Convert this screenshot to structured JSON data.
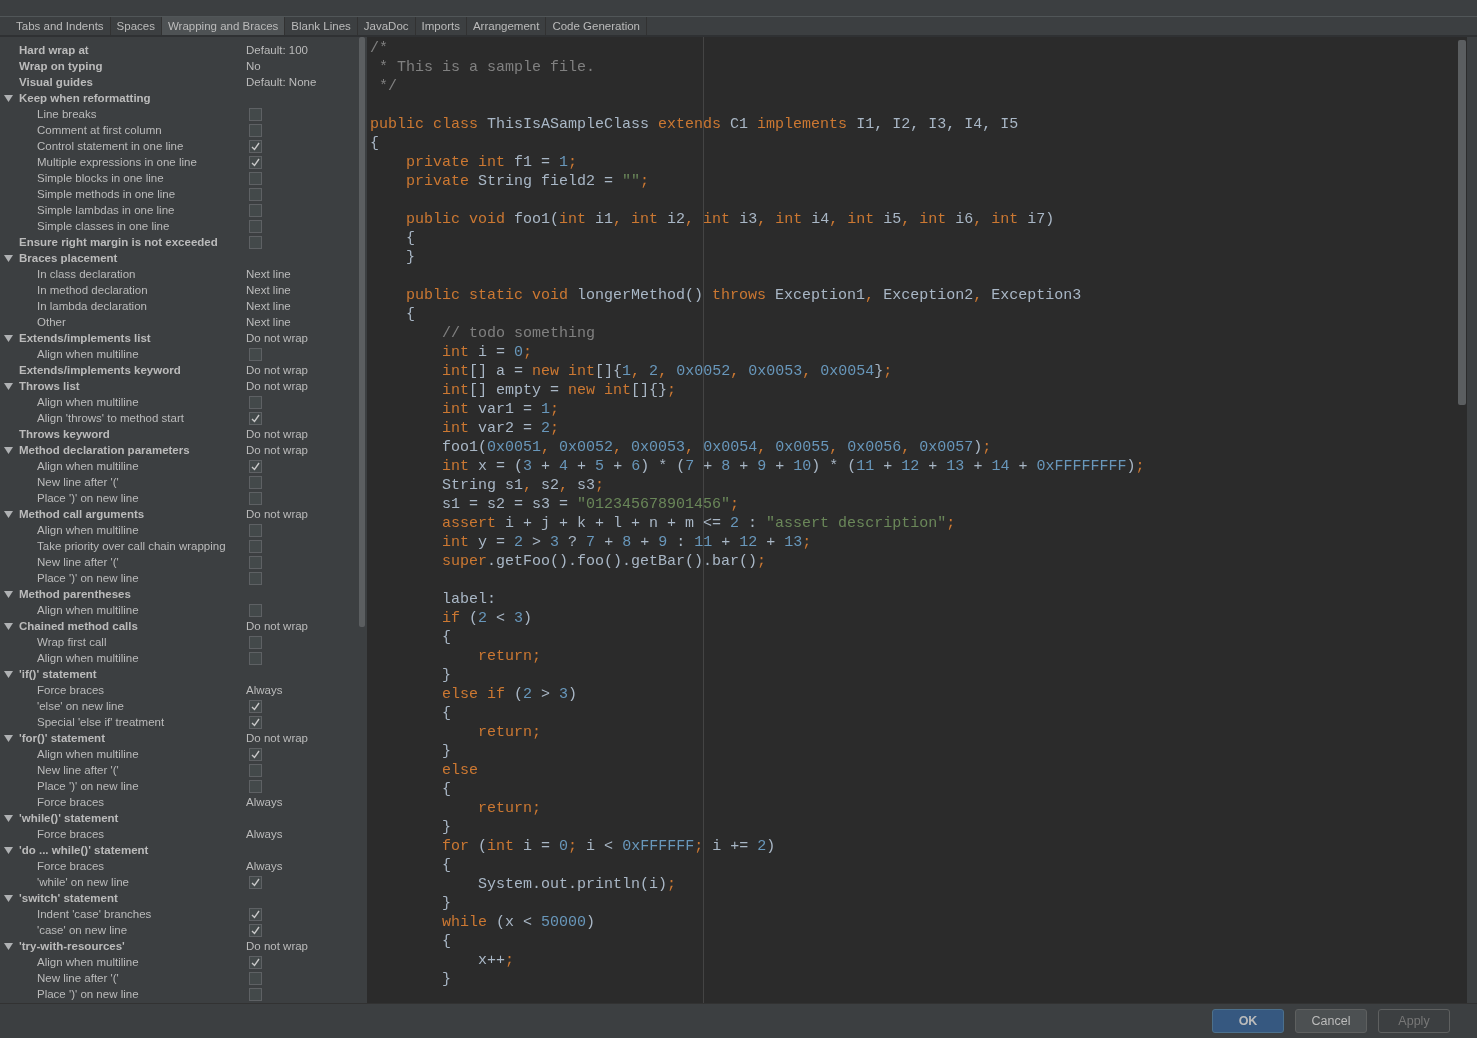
{
  "tabs": [
    {
      "label": "Tabs and Indents",
      "selected": false
    },
    {
      "label": "Spaces",
      "selected": false
    },
    {
      "label": "Wrapping and Braces",
      "selected": true
    },
    {
      "label": "Blank Lines",
      "selected": false
    },
    {
      "label": "JavaDoc",
      "selected": false
    },
    {
      "label": "Imports",
      "selected": false
    },
    {
      "label": "Arrangement",
      "selected": false
    },
    {
      "label": "Code Generation",
      "selected": false
    }
  ],
  "settings": [
    {
      "label": "Hard wrap at",
      "kind": "text",
      "value": "Default: 100"
    },
    {
      "label": "Wrap on typing",
      "kind": "text",
      "value": "No"
    },
    {
      "label": "Visual guides",
      "kind": "text",
      "value": "Default: None"
    },
    {
      "label": "Keep when reformatting",
      "kind": "none",
      "expanded": true,
      "children": [
        {
          "label": "Line breaks",
          "kind": "checkbox",
          "checked": false
        },
        {
          "label": "Comment at first column",
          "kind": "checkbox",
          "checked": false
        },
        {
          "label": "Control statement in one line",
          "kind": "checkbox",
          "checked": true
        },
        {
          "label": "Multiple expressions in one line",
          "kind": "checkbox",
          "checked": true
        },
        {
          "label": "Simple blocks in one line",
          "kind": "checkbox",
          "checked": false
        },
        {
          "label": "Simple methods in one line",
          "kind": "checkbox",
          "checked": false
        },
        {
          "label": "Simple lambdas in one line",
          "kind": "checkbox",
          "checked": false
        },
        {
          "label": "Simple classes in one line",
          "kind": "checkbox",
          "checked": false
        }
      ]
    },
    {
      "label": "Ensure right margin is not exceeded",
      "kind": "checkbox",
      "checked": false
    },
    {
      "label": "Braces placement",
      "kind": "none",
      "expanded": true,
      "children": [
        {
          "label": "In class declaration",
          "kind": "text",
          "value": "Next line"
        },
        {
          "label": "In method declaration",
          "kind": "text",
          "value": "Next line"
        },
        {
          "label": "In lambda declaration",
          "kind": "text",
          "value": "Next line"
        },
        {
          "label": "Other",
          "kind": "text",
          "value": "Next line"
        }
      ]
    },
    {
      "label": "Extends/implements list",
      "kind": "text",
      "value": "Do not wrap",
      "expanded": true,
      "children": [
        {
          "label": "Align when multiline",
          "kind": "checkbox",
          "checked": false
        }
      ]
    },
    {
      "label": "Extends/implements keyword",
      "kind": "text",
      "value": "Do not wrap"
    },
    {
      "label": "Throws list",
      "kind": "text",
      "value": "Do not wrap",
      "expanded": true,
      "children": [
        {
          "label": "Align when multiline",
          "kind": "checkbox",
          "checked": false
        },
        {
          "label": "Align 'throws' to method start",
          "kind": "checkbox",
          "checked": true
        }
      ]
    },
    {
      "label": "Throws keyword",
      "kind": "text",
      "value": "Do not wrap"
    },
    {
      "label": "Method declaration parameters",
      "kind": "text",
      "value": "Do not wrap",
      "expanded": true,
      "children": [
        {
          "label": "Align when multiline",
          "kind": "checkbox",
          "checked": true
        },
        {
          "label": "New line after '('",
          "kind": "checkbox",
          "checked": false
        },
        {
          "label": "Place ')' on new line",
          "kind": "checkbox",
          "checked": false
        }
      ]
    },
    {
      "label": "Method call arguments",
      "kind": "text",
      "value": "Do not wrap",
      "expanded": true,
      "children": [
        {
          "label": "Align when multiline",
          "kind": "checkbox",
          "checked": false
        },
        {
          "label": "Take priority over call chain wrapping",
          "kind": "checkbox",
          "checked": false
        },
        {
          "label": "New line after '('",
          "kind": "checkbox",
          "checked": false
        },
        {
          "label": "Place ')' on new line",
          "kind": "checkbox",
          "checked": false
        }
      ]
    },
    {
      "label": "Method parentheses",
      "kind": "none",
      "expanded": true,
      "children": [
        {
          "label": "Align when multiline",
          "kind": "checkbox",
          "checked": false
        }
      ]
    },
    {
      "label": "Chained method calls",
      "kind": "text",
      "value": "Do not wrap",
      "expanded": true,
      "children": [
        {
          "label": "Wrap first call",
          "kind": "checkbox",
          "checked": false
        },
        {
          "label": "Align when multiline",
          "kind": "checkbox",
          "checked": false
        }
      ]
    },
    {
      "label": "'if()' statement",
      "kind": "none",
      "expanded": true,
      "children": [
        {
          "label": "Force braces",
          "kind": "text",
          "value": "Always"
        },
        {
          "label": "'else' on new line",
          "kind": "checkbox",
          "checked": true
        },
        {
          "label": "Special 'else if' treatment",
          "kind": "checkbox",
          "checked": true
        }
      ]
    },
    {
      "label": "'for()' statement",
      "kind": "text",
      "value": "Do not wrap",
      "expanded": true,
      "children": [
        {
          "label": "Align when multiline",
          "kind": "checkbox",
          "checked": true
        },
        {
          "label": "New line after '('",
          "kind": "checkbox",
          "checked": false
        },
        {
          "label": "Place ')' on new line",
          "kind": "checkbox",
          "checked": false
        },
        {
          "label": "Force braces",
          "kind": "text",
          "value": "Always"
        }
      ]
    },
    {
      "label": "'while()' statement",
      "kind": "none",
      "expanded": true,
      "children": [
        {
          "label": "Force braces",
          "kind": "text",
          "value": "Always"
        }
      ]
    },
    {
      "label": "'do ... while()' statement",
      "kind": "none",
      "expanded": true,
      "children": [
        {
          "label": "Force braces",
          "kind": "text",
          "value": "Always"
        },
        {
          "label": "'while' on new line",
          "kind": "checkbox",
          "checked": true
        }
      ]
    },
    {
      "label": "'switch' statement",
      "kind": "none",
      "expanded": true,
      "children": [
        {
          "label": "Indent 'case' branches",
          "kind": "checkbox",
          "checked": true
        },
        {
          "label": "'case' on new line",
          "kind": "checkbox",
          "checked": true
        }
      ]
    },
    {
      "label": "'try-with-resources'",
      "kind": "text",
      "value": "Do not wrap",
      "expanded": true,
      "children": [
        {
          "label": "Align when multiline",
          "kind": "checkbox",
          "checked": true
        },
        {
          "label": "New line after '('",
          "kind": "checkbox",
          "checked": false
        },
        {
          "label": "Place ')' on new line",
          "kind": "checkbox",
          "checked": false
        }
      ]
    }
  ],
  "code_lines": [
    [
      {
        "kind": "comment",
        "text": "/*"
      }
    ],
    [
      {
        "kind": "comment",
        "text": " * This is a sample file."
      }
    ],
    [
      {
        "kind": "comment",
        "text": " */"
      }
    ],
    {
      "blank_before": true,
      "tokens": [
        {
          "kind": "keyword",
          "text": "public class "
        },
        {
          "kind": "plain",
          "text": "ThisIsASampleClass "
        },
        {
          "kind": "keyword",
          "text": "extends "
        },
        {
          "kind": "plain",
          "text": "C1 "
        },
        {
          "kind": "keyword",
          "text": "implements "
        },
        {
          "kind": "plain",
          "text": "I1, I2, I3, I4, I5"
        }
      ]
    },
    [
      {
        "kind": "plain",
        "text": "{"
      }
    ],
    [
      {
        "kind": "keyword",
        "text": "    private int "
      },
      {
        "kind": "plain",
        "text": "f1 = "
      },
      {
        "kind": "number",
        "text": "1"
      },
      {
        "kind": "keyword",
        "text": ";"
      }
    ],
    [
      {
        "kind": "keyword",
        "text": "    private "
      },
      {
        "kind": "plain",
        "text": "String field2 = "
      },
      {
        "kind": "string",
        "text": "\"\""
      },
      {
        "kind": "keyword",
        "text": ";"
      }
    ],
    {
      "blank_before": true,
      "tokens": [
        {
          "kind": "keyword",
          "text": "    public void "
        },
        {
          "kind": "plain",
          "text": "foo1("
        },
        {
          "kind": "keyword",
          "text": "int "
        },
        {
          "kind": "plain",
          "text": "i1"
        },
        {
          "kind": "keyword",
          "text": ", int "
        },
        {
          "kind": "plain",
          "text": "i2"
        },
        {
          "kind": "keyword",
          "text": ", int "
        },
        {
          "kind": "plain",
          "text": "i3"
        },
        {
          "kind": "keyword",
          "text": ", int "
        },
        {
          "kind": "plain",
          "text": "i4"
        },
        {
          "kind": "keyword",
          "text": ", int "
        },
        {
          "kind": "plain",
          "text": "i5"
        },
        {
          "kind": "keyword",
          "text": ", int "
        },
        {
          "kind": "plain",
          "text": "i6"
        },
        {
          "kind": "keyword",
          "text": ", int "
        },
        {
          "kind": "plain",
          "text": "i7)"
        }
      ]
    },
    [
      {
        "kind": "plain",
        "text": "    {"
      }
    ],
    [
      {
        "kind": "plain",
        "text": "    }"
      }
    ],
    {
      "blank_before": true,
      "tokens": [
        {
          "kind": "keyword",
          "text": "    public static void "
        },
        {
          "kind": "plain",
          "text": "longerMethod() "
        },
        {
          "kind": "keyword",
          "text": "throws "
        },
        {
          "kind": "plain",
          "text": "Exception1"
        },
        {
          "kind": "keyword",
          "text": ", "
        },
        {
          "kind": "plain",
          "text": "Exception2"
        },
        {
          "kind": "keyword",
          "text": ", "
        },
        {
          "kind": "plain",
          "text": "Exception3"
        }
      ]
    },
    [
      {
        "kind": "plain",
        "text": "    {"
      }
    ],
    [
      {
        "kind": "comment",
        "text": "        // todo something"
      }
    ],
    [
      {
        "kind": "keyword",
        "text": "        int "
      },
      {
        "kind": "plain",
        "text": "i = "
      },
      {
        "kind": "number",
        "text": "0"
      },
      {
        "kind": "keyword",
        "text": ";"
      }
    ],
    [
      {
        "kind": "keyword",
        "text": "        int"
      },
      {
        "kind": "plain",
        "text": "[] a = "
      },
      {
        "kind": "keyword",
        "text": "new int"
      },
      {
        "kind": "plain",
        "text": "[]{"
      },
      {
        "kind": "number",
        "text": "1"
      },
      {
        "kind": "keyword",
        "text": ", "
      },
      {
        "kind": "number",
        "text": "2"
      },
      {
        "kind": "keyword",
        "text": ", "
      },
      {
        "kind": "number",
        "text": "0x0052"
      },
      {
        "kind": "keyword",
        "text": ", "
      },
      {
        "kind": "number",
        "text": "0x0053"
      },
      {
        "kind": "keyword",
        "text": ", "
      },
      {
        "kind": "number",
        "text": "0x0054"
      },
      {
        "kind": "plain",
        "text": "}"
      },
      {
        "kind": "keyword",
        "text": ";"
      }
    ],
    [
      {
        "kind": "keyword",
        "text": "        int"
      },
      {
        "kind": "plain",
        "text": "[] empty = "
      },
      {
        "kind": "keyword",
        "text": "new int"
      },
      {
        "kind": "plain",
        "text": "[]{}"
      },
      {
        "kind": "keyword",
        "text": ";"
      }
    ],
    [
      {
        "kind": "keyword",
        "text": "        int "
      },
      {
        "kind": "plain",
        "text": "var1 = "
      },
      {
        "kind": "number",
        "text": "1"
      },
      {
        "kind": "keyword",
        "text": ";"
      }
    ],
    [
      {
        "kind": "keyword",
        "text": "        int "
      },
      {
        "kind": "plain",
        "text": "var2 = "
      },
      {
        "kind": "number",
        "text": "2"
      },
      {
        "kind": "keyword",
        "text": ";"
      }
    ],
    [
      {
        "kind": "plain",
        "text": "        foo1("
      },
      {
        "kind": "number",
        "text": "0x0051"
      },
      {
        "kind": "keyword",
        "text": ", "
      },
      {
        "kind": "number",
        "text": "0x0052"
      },
      {
        "kind": "keyword",
        "text": ", "
      },
      {
        "kind": "number",
        "text": "0x0053"
      },
      {
        "kind": "keyword",
        "text": ", "
      },
      {
        "kind": "number",
        "text": "0x0054"
      },
      {
        "kind": "keyword",
        "text": ", "
      },
      {
        "kind": "number",
        "text": "0x0055"
      },
      {
        "kind": "keyword",
        "text": ", "
      },
      {
        "kind": "number",
        "text": "0x0056"
      },
      {
        "kind": "keyword",
        "text": ", "
      },
      {
        "kind": "number",
        "text": "0x0057"
      },
      {
        "kind": "plain",
        "text": ")"
      },
      {
        "kind": "keyword",
        "text": ";"
      }
    ],
    [
      {
        "kind": "keyword",
        "text": "        int "
      },
      {
        "kind": "plain",
        "text": "x = ("
      },
      {
        "kind": "number",
        "text": "3"
      },
      {
        "kind": "plain",
        "text": " + "
      },
      {
        "kind": "number",
        "text": "4"
      },
      {
        "kind": "plain",
        "text": " + "
      },
      {
        "kind": "number",
        "text": "5"
      },
      {
        "kind": "plain",
        "text": " + "
      },
      {
        "kind": "number",
        "text": "6"
      },
      {
        "kind": "plain",
        "text": ") * ("
      },
      {
        "kind": "number",
        "text": "7"
      },
      {
        "kind": "plain",
        "text": " + "
      },
      {
        "kind": "number",
        "text": "8"
      },
      {
        "kind": "plain",
        "text": " + "
      },
      {
        "kind": "number",
        "text": "9"
      },
      {
        "kind": "plain",
        "text": " + "
      },
      {
        "kind": "number",
        "text": "10"
      },
      {
        "kind": "plain",
        "text": ") * ("
      },
      {
        "kind": "number",
        "text": "11"
      },
      {
        "kind": "plain",
        "text": " + "
      },
      {
        "kind": "number",
        "text": "12"
      },
      {
        "kind": "plain",
        "text": " + "
      },
      {
        "kind": "number",
        "text": "13"
      },
      {
        "kind": "plain",
        "text": " + "
      },
      {
        "kind": "number",
        "text": "14"
      },
      {
        "kind": "plain",
        "text": " + "
      },
      {
        "kind": "number",
        "text": "0xFFFFFFFF"
      },
      {
        "kind": "plain",
        "text": ")"
      },
      {
        "kind": "keyword",
        "text": ";"
      }
    ],
    [
      {
        "kind": "plain",
        "text": "        String s1"
      },
      {
        "kind": "keyword",
        "text": ", "
      },
      {
        "kind": "plain",
        "text": "s2"
      },
      {
        "kind": "keyword",
        "text": ", "
      },
      {
        "kind": "plain",
        "text": "s3"
      },
      {
        "kind": "keyword",
        "text": ";"
      }
    ],
    [
      {
        "kind": "plain",
        "text": "        s1 = s2 = s3 = "
      },
      {
        "kind": "string",
        "text": "\"012345678901456\""
      },
      {
        "kind": "keyword",
        "text": ";"
      }
    ],
    [
      {
        "kind": "keyword",
        "text": "        assert "
      },
      {
        "kind": "plain",
        "text": "i + j + k + l + n + m <= "
      },
      {
        "kind": "number",
        "text": "2"
      },
      {
        "kind": "plain",
        "text": " : "
      },
      {
        "kind": "string",
        "text": "\"assert description\""
      },
      {
        "kind": "keyword",
        "text": ";"
      }
    ],
    [
      {
        "kind": "keyword",
        "text": "        int "
      },
      {
        "kind": "plain",
        "text": "y = "
      },
      {
        "kind": "number",
        "text": "2"
      },
      {
        "kind": "plain",
        "text": " > "
      },
      {
        "kind": "number",
        "text": "3"
      },
      {
        "kind": "plain",
        "text": " ? "
      },
      {
        "kind": "number",
        "text": "7"
      },
      {
        "kind": "plain",
        "text": " + "
      },
      {
        "kind": "number",
        "text": "8"
      },
      {
        "kind": "plain",
        "text": " + "
      },
      {
        "kind": "number",
        "text": "9"
      },
      {
        "kind": "plain",
        "text": " : "
      },
      {
        "kind": "number",
        "text": "11"
      },
      {
        "kind": "plain",
        "text": " + "
      },
      {
        "kind": "number",
        "text": "12"
      },
      {
        "kind": "plain",
        "text": " + "
      },
      {
        "kind": "number",
        "text": "13"
      },
      {
        "kind": "keyword",
        "text": ";"
      }
    ],
    [
      {
        "kind": "keyword",
        "text": "        super"
      },
      {
        "kind": "plain",
        "text": ".getFoo().foo().getBar().bar()"
      },
      {
        "kind": "keyword",
        "text": ";"
      }
    ],
    {
      "blank_before": true,
      "tokens": [
        {
          "kind": "plain",
          "text": "        label:"
        }
      ]
    },
    [
      {
        "kind": "keyword",
        "text": "        if "
      },
      {
        "kind": "plain",
        "text": "("
      },
      {
        "kind": "number",
        "text": "2"
      },
      {
        "kind": "plain",
        "text": " < "
      },
      {
        "kind": "number",
        "text": "3"
      },
      {
        "kind": "plain",
        "text": ")"
      }
    ],
    [
      {
        "kind": "plain",
        "text": "        {"
      }
    ],
    [
      {
        "kind": "keyword",
        "text": "            return;"
      }
    ],
    [
      {
        "kind": "plain",
        "text": "        }"
      }
    ],
    [
      {
        "kind": "keyword",
        "text": "        else if "
      },
      {
        "kind": "plain",
        "text": "("
      },
      {
        "kind": "number",
        "text": "2"
      },
      {
        "kind": "plain",
        "text": " > "
      },
      {
        "kind": "number",
        "text": "3"
      },
      {
        "kind": "plain",
        "text": ")"
      }
    ],
    [
      {
        "kind": "plain",
        "text": "        {"
      }
    ],
    [
      {
        "kind": "keyword",
        "text": "            return;"
      }
    ],
    [
      {
        "kind": "plain",
        "text": "        }"
      }
    ],
    [
      {
        "kind": "keyword",
        "text": "        else"
      }
    ],
    [
      {
        "kind": "plain",
        "text": "        {"
      }
    ],
    [
      {
        "kind": "keyword",
        "text": "            return;"
      }
    ],
    [
      {
        "kind": "plain",
        "text": "        }"
      }
    ],
    [
      {
        "kind": "keyword",
        "text": "        for "
      },
      {
        "kind": "plain",
        "text": "("
      },
      {
        "kind": "keyword",
        "text": "int "
      },
      {
        "kind": "plain",
        "text": "i = "
      },
      {
        "kind": "number",
        "text": "0"
      },
      {
        "kind": "keyword",
        "text": "; "
      },
      {
        "kind": "plain",
        "text": "i < "
      },
      {
        "kind": "number",
        "text": "0xFFFFFF"
      },
      {
        "kind": "keyword",
        "text": "; "
      },
      {
        "kind": "plain",
        "text": "i += "
      },
      {
        "kind": "number",
        "text": "2"
      },
      {
        "kind": "plain",
        "text": ")"
      }
    ],
    [
      {
        "kind": "plain",
        "text": "        {"
      }
    ],
    [
      {
        "kind": "plain",
        "text": "            System.out.println(i)"
      },
      {
        "kind": "keyword",
        "text": ";"
      }
    ],
    [
      {
        "kind": "plain",
        "text": "        }"
      }
    ],
    [
      {
        "kind": "keyword",
        "text": "        while "
      },
      {
        "kind": "plain",
        "text": "(x < "
      },
      {
        "kind": "number",
        "text": "50000"
      },
      {
        "kind": "plain",
        "text": ")"
      }
    ],
    [
      {
        "kind": "plain",
        "text": "        {"
      }
    ],
    [
      {
        "kind": "plain",
        "text": "            x++"
      },
      {
        "kind": "keyword",
        "text": ";"
      }
    ],
    [
      {
        "kind": "plain",
        "text": "        }"
      }
    ]
  ],
  "buttons": [
    {
      "label": "OK",
      "kind": "primary",
      "disabled": false
    },
    {
      "label": "Cancel",
      "kind": "default",
      "disabled": false
    },
    {
      "label": "Apply",
      "kind": "default",
      "disabled": true
    }
  ]
}
